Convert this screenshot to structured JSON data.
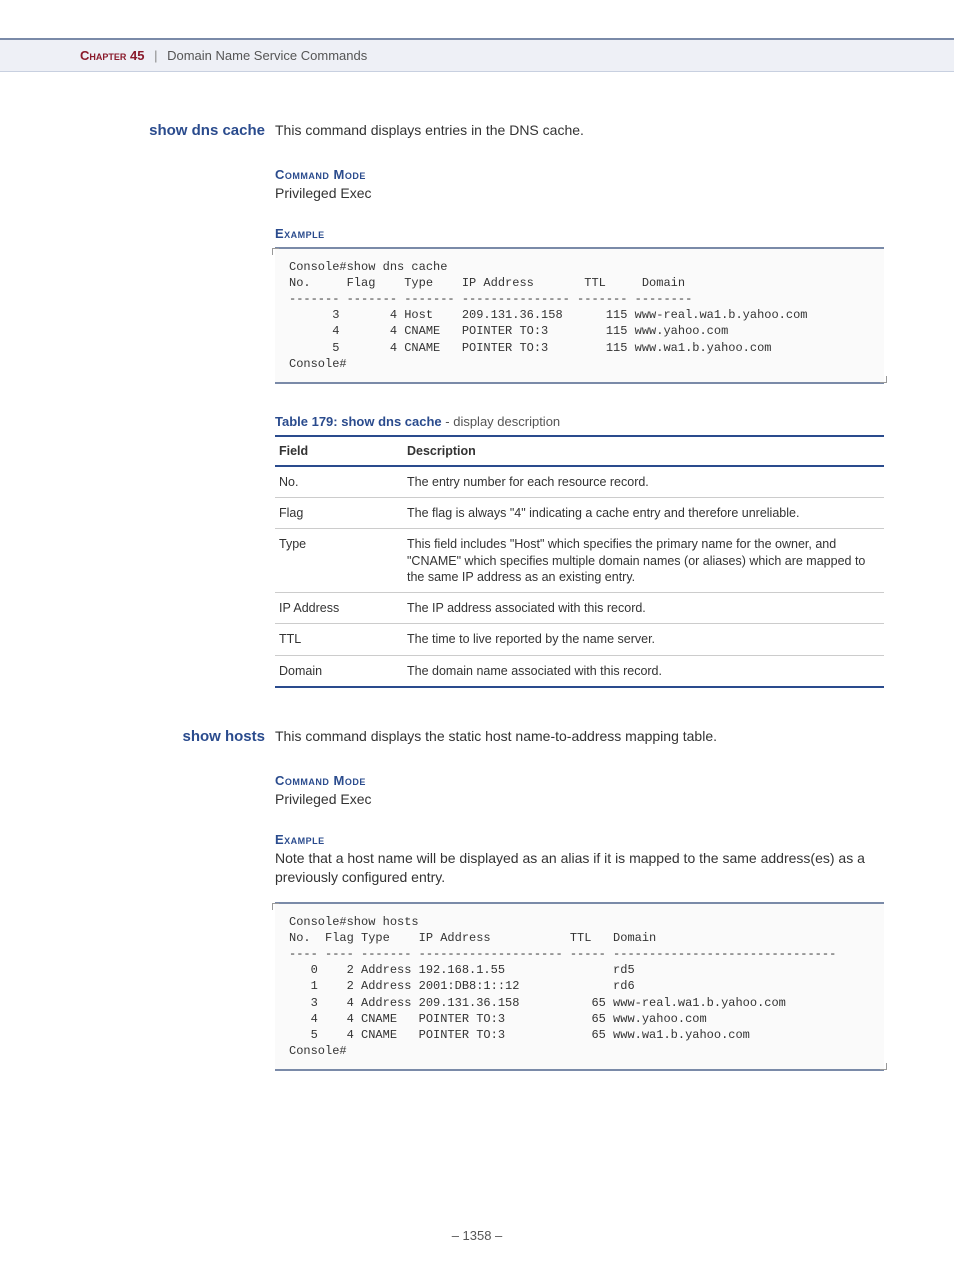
{
  "header": {
    "chapter": "Chapter 45",
    "separator": "|",
    "title": "Domain Name Service Commands"
  },
  "commands": [
    {
      "name": "show dns cache",
      "description": "This command displays entries in the DNS cache.",
      "mode_heading": "Command Mode",
      "mode_text": "Privileged Exec",
      "example_heading": "Example",
      "example_note": "",
      "console": "Console#show dns cache\nNo.     Flag    Type    IP Address       TTL     Domain\n------- ------- ------- --------------- ------- --------\n      3       4 Host    209.131.36.158      115 www-real.wa1.b.yahoo.com\n      4       4 CNAME   POINTER TO:3        115 www.yahoo.com\n      5       4 CNAME   POINTER TO:3        115 www.wa1.b.yahoo.com\nConsole#",
      "table": {
        "caption_bold": "Table 179: show dns cache",
        "caption_rest": " - display description",
        "columns": [
          "Field",
          "Description"
        ],
        "rows": [
          {
            "field": "No.",
            "desc": "The entry number for each resource record."
          },
          {
            "field": "Flag",
            "desc": "The flag is always \"4\" indicating a cache entry and therefore unreliable."
          },
          {
            "field": "Type",
            "desc": "This field includes \"Host\" which specifies the primary name for the owner, and \"CNAME\" which specifies multiple domain names (or aliases) which are mapped to the same IP address as an existing entry."
          },
          {
            "field": "IP Address",
            "desc": "The IP address associated with this record."
          },
          {
            "field": "TTL",
            "desc": "The time to live reported by the name server."
          },
          {
            "field": "Domain",
            "desc": "The domain name associated with this record."
          }
        ]
      }
    },
    {
      "name": "show hosts",
      "description": "This command displays the static host name-to-address mapping table.",
      "mode_heading": "Command Mode",
      "mode_text": "Privileged Exec",
      "example_heading": "Example",
      "example_note": "Note that a host name will be displayed as an alias if it is mapped to the same address(es) as a previously configured entry.",
      "console": "Console#show hosts\nNo.  Flag Type    IP Address           TTL   Domain\n---- ---- ------- -------------------- ----- -------------------------------\n   0    2 Address 192.168.1.55               rd5\n   1    2 Address 2001:DB8:1::12             rd6\n   3    4 Address 209.131.36.158          65 www-real.wa1.b.yahoo.com\n   4    4 CNAME   POINTER TO:3            65 www.yahoo.com\n   5    4 CNAME   POINTER TO:3            65 www.wa1.b.yahoo.com\nConsole#"
    }
  ],
  "page_number": "– 1358 –"
}
